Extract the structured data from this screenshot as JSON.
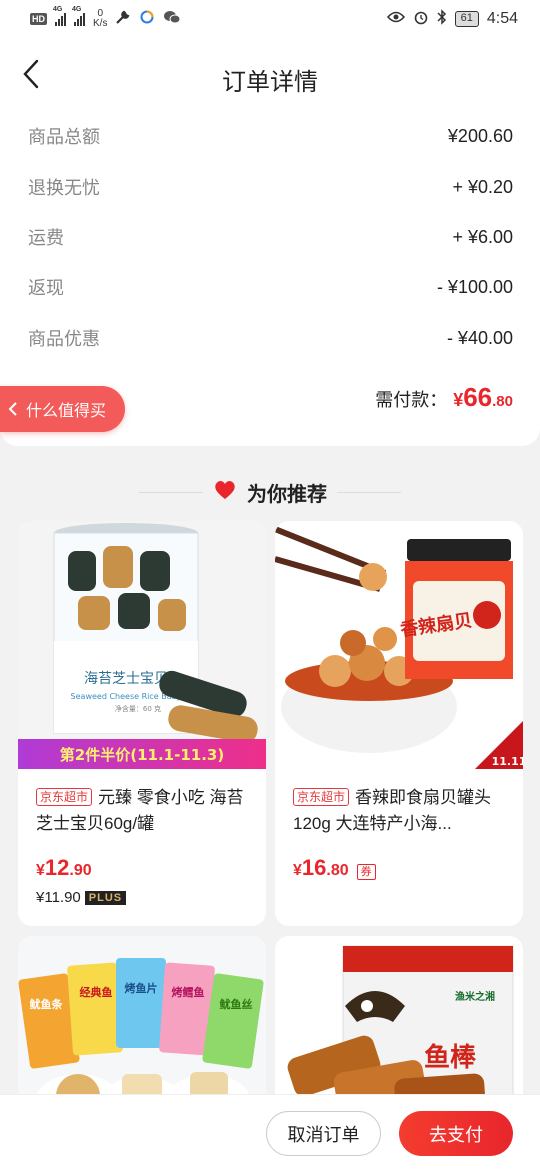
{
  "status_bar": {
    "network_badge": "HD",
    "signal1": "4G",
    "signal2": "4G",
    "speed_value": "0",
    "speed_unit": "K/s",
    "battery": "61",
    "time": "4:54"
  },
  "header": {
    "title": "订单详情"
  },
  "fees": [
    {
      "label": "商品总额",
      "value": "¥200.60"
    },
    {
      "label": "退换无忧",
      "value": "+ ¥0.20"
    },
    {
      "label": "运费",
      "value": "+ ¥6.00"
    },
    {
      "label": "返现",
      "value": "- ¥100.00"
    },
    {
      "label": "商品优惠",
      "value": "- ¥40.00"
    }
  ],
  "worth_button": {
    "label": "什么值得买"
  },
  "payment": {
    "label": "需付款：",
    "currency": "¥",
    "integer": "66",
    "decimal": ".80"
  },
  "recommend": {
    "title": "为你推荐"
  },
  "products": [
    {
      "tag": "京东超市",
      "name": "元臻 零食小吃 海苔芝士宝贝60g/罐",
      "currency": "¥",
      "price_int": "12",
      "price_dec": ".90",
      "plus_price": "¥11.90",
      "plus_badge": "PLUS",
      "banner": "第2件半价(11.1-11.3)",
      "jar_text_cn": "海苔芝士宝贝",
      "jar_text_en": "Seaweed Cheese Rice Baby",
      "jar_net": "净含量：60 克"
    },
    {
      "tag": "京东超市",
      "name": "香辣即食扇贝罐头 120g 大连特产小海...",
      "currency": "¥",
      "price_int": "16",
      "price_dec": ".80",
      "coupon": "券",
      "jar_label": "香辣扇贝",
      "corner_badge": "11.11"
    },
    {
      "packs": [
        "鱿鱼条",
        "经典鱼",
        "烤鱼片",
        "烤鳕鱼",
        "鱿鱼丝"
      ]
    },
    {
      "box_brand": "渔米之湘",
      "box_text": "鱼棒"
    }
  ],
  "actions": {
    "cancel": "取消订单",
    "pay": "去支付"
  },
  "colors": {
    "accent": "#e8262c",
    "worth_button": "#f35a5a"
  }
}
